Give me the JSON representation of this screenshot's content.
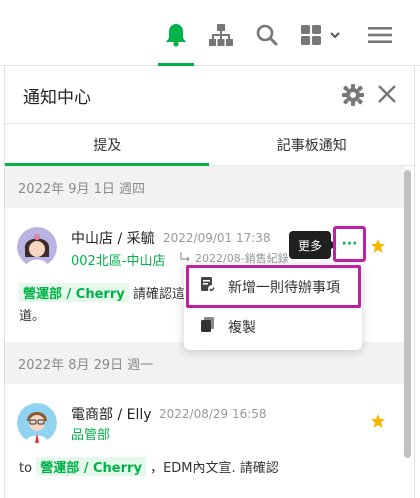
{
  "colors": {
    "accent": "#00b248",
    "highlight": "#c21fa6",
    "star": "#f5b700"
  },
  "panel": {
    "title": "通知中心",
    "tabs": [
      {
        "label": "提及"
      },
      {
        "label": "記事板通知"
      }
    ]
  },
  "notifications": [
    {
      "date": "2022年 9月 1日 週四",
      "sender": "中山店 / 采毓",
      "timestamp": "2022/09/01 17:38",
      "dept": "002北區-中山店",
      "ref": "2022/08-銷售紀錄",
      "mention": "營運部 / Cherry",
      "text": "請確認這",
      "text_cont": "道。"
    },
    {
      "date": "2022年 8月 29日 週一",
      "sender": "電商部 / Elly",
      "timestamp": "2022/08/29 16:58",
      "dept": "品管部",
      "prefix": "to",
      "mention": "營運部 / Cherry",
      "text": "，EDM內文宣. 請確認"
    }
  ],
  "tooltip": "更多",
  "more_glyph": "···",
  "menu": {
    "items": [
      {
        "label": "新增一則待辦事項"
      },
      {
        "label": "複製"
      }
    ]
  }
}
